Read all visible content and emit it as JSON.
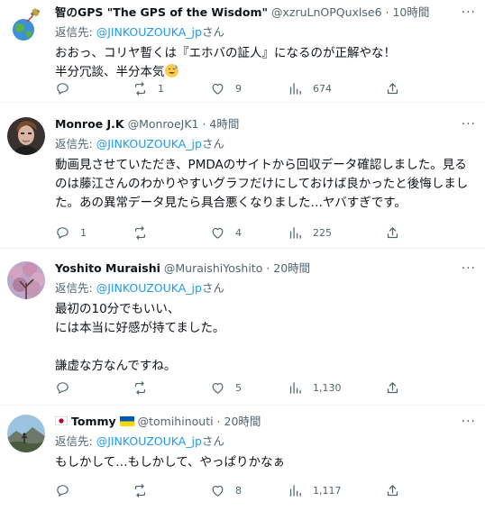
{
  "tweets": [
    {
      "name": "智のGPS \"The GPS of the Wisdom\"",
      "handle": "@xzruLnOPQuxlse6",
      "time": "10時間",
      "reply_prefix": "返信先: ",
      "reply_handle": "@JINKOUZOUKA_jp",
      "reply_suffix": "さん",
      "text": "おおっ、コリヤ暫くは『エホバの証人』になるのが正解やな！\n半分冗談、半分本気",
      "replies": "",
      "retweets": "1",
      "likes": "9",
      "views": "674"
    },
    {
      "name": "Monroe J.K",
      "handle": "@MonroeJK1",
      "time": "4時間",
      "reply_prefix": "返信先: ",
      "reply_handle": "@JINKOUZOUKA_jp",
      "reply_suffix": "さん",
      "text": "動画見させていただき、PMDAのサイトから回収データ確認しました。見るのは藤江さんのわかりやすいグラフだけにしておけば良かったと後悔しました。あの異常データ見たら具合悪くなりました…ヤバすぎです。",
      "replies": "1",
      "retweets": "",
      "likes": "4",
      "views": "225"
    },
    {
      "name": "Yoshito Muraishi",
      "handle": "@MuraishiYoshito",
      "time": "20時間",
      "reply_prefix": "返信先: ",
      "reply_handle": "@JINKOUZOUKA_jp",
      "reply_suffix": "さん",
      "text": "最初の10分でもいい、\nには本当に好感が持てました。\n\n謙虚な方なんですね。",
      "replies": "",
      "retweets": "",
      "likes": "5",
      "views": "1,130"
    },
    {
      "name": "Tommy",
      "handle": "@tomihinouti",
      "time": "20時間",
      "reply_prefix": "返信先: ",
      "reply_handle": "@JINKOUZOUKA_jp",
      "reply_suffix": "さん",
      "text": "もしかして…もしかして、やっぱりかなぁ",
      "replies": "",
      "retweets": "",
      "likes": "8",
      "views": "1,117"
    }
  ],
  "meta_separator": " · ",
  "more_label": "···",
  "icons": {
    "reply": "speech-bubble-icon",
    "retweet": "retweet-arrows-icon",
    "like": "heart-icon",
    "views": "bar-chart-icon",
    "share": "share-upload-icon",
    "emoji": "sweat-smile-emoji-icon",
    "flags": [
      "japan-flag-icon",
      "ukraine-flag-icon"
    ]
  },
  "colors": {
    "text": "#0f1419",
    "secondary": "#536471",
    "link": "#1d9bf0",
    "divider": "#eff3f4"
  }
}
